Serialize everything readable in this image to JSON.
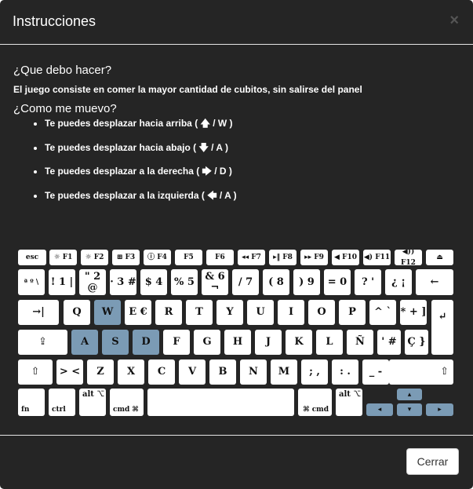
{
  "modal": {
    "title": "Instrucciones",
    "close_glyph": "×",
    "q1": "¿Que debo hacer?",
    "goal": "El juego consiste en comer la mayor cantidad de cubitos, sin salirse del panel",
    "q2": "¿Como me muevo?",
    "moves": [
      "Te puedes desplazar hacia arriba ( 🡅 / W )",
      "Te puedes desplazar hacia abajo ( 🡇 / A )",
      "Te puedes desplazar a la derecha ( 🡆 / D )",
      "Te puedes desplazar a la izquierda ( 🡄 / A )"
    ],
    "close_button": "Cerrar"
  },
  "keyboard": {
    "highlight_color": "#7b9bb5",
    "highlighted_keys": [
      "W",
      "A",
      "S",
      "D",
      "up-arrow",
      "left-arrow",
      "down-arrow",
      "right-arrow"
    ],
    "row1": [
      "esc",
      "☼ F1",
      "☼ F2",
      "⊞ F3",
      "ⓘ F4",
      "F5",
      "F6",
      "◂◂ F7",
      "▸‖ F8",
      "▸▸ F9",
      "◀ F10",
      "◀) F11",
      "◀)) F12",
      "⏏"
    ],
    "row2": [
      "ª º \\",
      "! 1 |",
      "\" 2 @",
      "· 3 #",
      "$ 4",
      "% 5",
      "& 6 ¬",
      "/ 7",
      "( 8",
      ") 9",
      "= 0",
      "? '",
      "¿ ¡",
      "←"
    ],
    "row3": [
      "→|",
      "Q",
      "W",
      "E €",
      "R",
      "T",
      "Y",
      "U",
      "I",
      "O",
      "P",
      "^ `",
      "* + ]",
      "↵"
    ],
    "row4": [
      "⇪",
      "A",
      "S",
      "D",
      "F",
      "G",
      "H",
      "J",
      "K",
      "L",
      "Ñ",
      "' #",
      "Ç }"
    ],
    "row5": [
      "⇧",
      "> <",
      "Z",
      "X",
      "C",
      "V",
      "B",
      "N",
      "M",
      "; ,",
      ": .",
      "_ -",
      "⇧"
    ],
    "row6": [
      "fn",
      "ctrl",
      "alt ⌥",
      "cmd ⌘",
      "space",
      "⌘ cmd",
      "alt ⌥"
    ]
  }
}
